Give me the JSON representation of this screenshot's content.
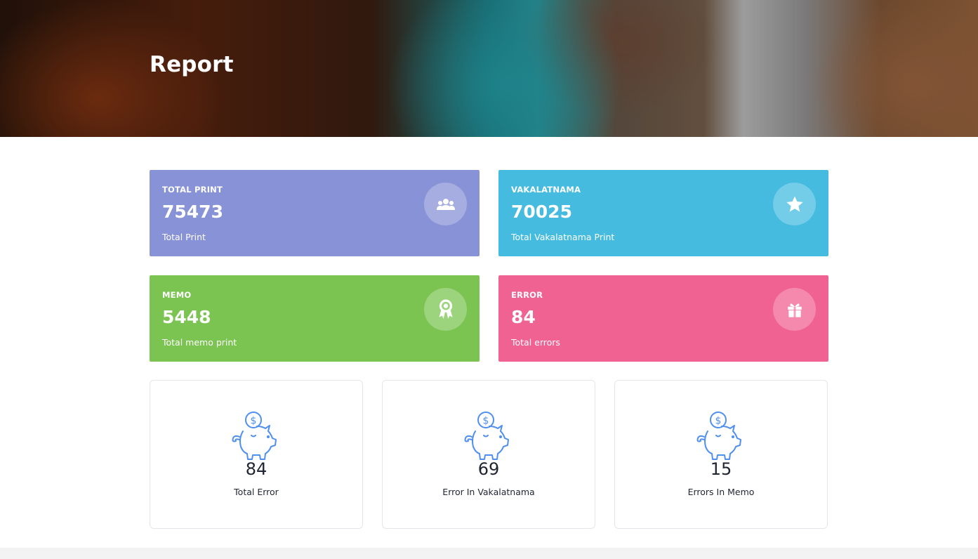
{
  "header": {
    "title": "Report"
  },
  "cards": [
    {
      "label": "TOTAL PRINT",
      "value": "75473",
      "sub": "Total Print",
      "color": "#8892d7",
      "icon": "users-icon"
    },
    {
      "label": "VAKALATNAMA",
      "value": "70025",
      "sub": "Total Vakalatnama Print",
      "color": "#45bbe0",
      "icon": "star-icon"
    },
    {
      "label": "MEMO",
      "value": "5448",
      "sub": "Total memo print",
      "color": "#7bc452",
      "icon": "award-icon"
    },
    {
      "label": "ERROR",
      "value": "84",
      "sub": "Total errors",
      "color": "#f06292",
      "icon": "gift-icon"
    }
  ],
  "stats": [
    {
      "value": "84",
      "label": "Total Error",
      "icon": "piggy-bank-icon"
    },
    {
      "value": "69",
      "label": "Error In Vakalatnama",
      "icon": "piggy-bank-icon"
    },
    {
      "value": "15",
      "label": "Errors In Memo",
      "icon": "piggy-bank-icon"
    }
  ],
  "colors": {
    "icon_accent": "#4f8ff0",
    "text_dark": "#1f2433"
  }
}
